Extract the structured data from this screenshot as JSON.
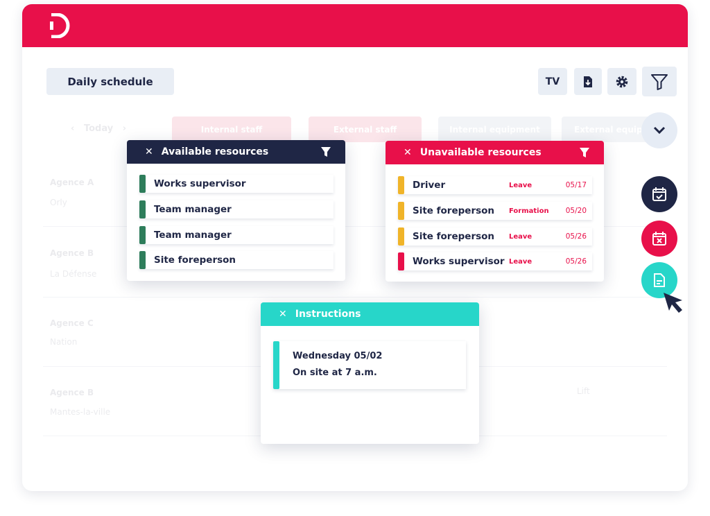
{
  "app": {
    "logo": "D"
  },
  "toolbar": {
    "title": "Daily schedule",
    "tv": "TV",
    "icons": [
      "export-file-icon",
      "gear-icon",
      "filter-icon"
    ]
  },
  "schedule": {
    "nav": {
      "label": "Today"
    },
    "tabs": [
      "Internal staff",
      "External staff",
      "Internal equipment",
      "External equip"
    ],
    "rows": [
      {
        "agency": "Agence A",
        "site": "Orly"
      },
      {
        "agency": "Agence B",
        "site": "La Défense"
      },
      {
        "agency": "Agence C",
        "site": "Nation"
      },
      {
        "agency": "Agence B",
        "site": "Mantes-la-ville"
      }
    ],
    "faded_item": "Lift"
  },
  "available": {
    "title": "Available resources",
    "items": [
      "Works supervisor",
      "Team manager",
      "Team manager",
      "Site foreperson"
    ]
  },
  "unavailable": {
    "title": "Unavailable resources",
    "items": [
      {
        "name": "Driver",
        "status": "Leave",
        "date": "05/17",
        "color": "#f0b429"
      },
      {
        "name": "Site foreperson",
        "status": "Formation",
        "date": "05/20",
        "color": "#f0b429"
      },
      {
        "name": "Site foreperson",
        "status": "Leave",
        "date": "05/26",
        "color": "#f0b429"
      },
      {
        "name": "Works supervisor",
        "status": "Leave",
        "date": "05/26",
        "color": "#e8104a"
      }
    ]
  },
  "instructions": {
    "title": "Instructions",
    "line1": "Wednesday 05/02",
    "line2": "On site at 7 a.m."
  },
  "colors": {
    "brand": "#e8104a",
    "navy": "#1f2645",
    "teal": "#27d6c9",
    "green": "#2e7d5b"
  }
}
